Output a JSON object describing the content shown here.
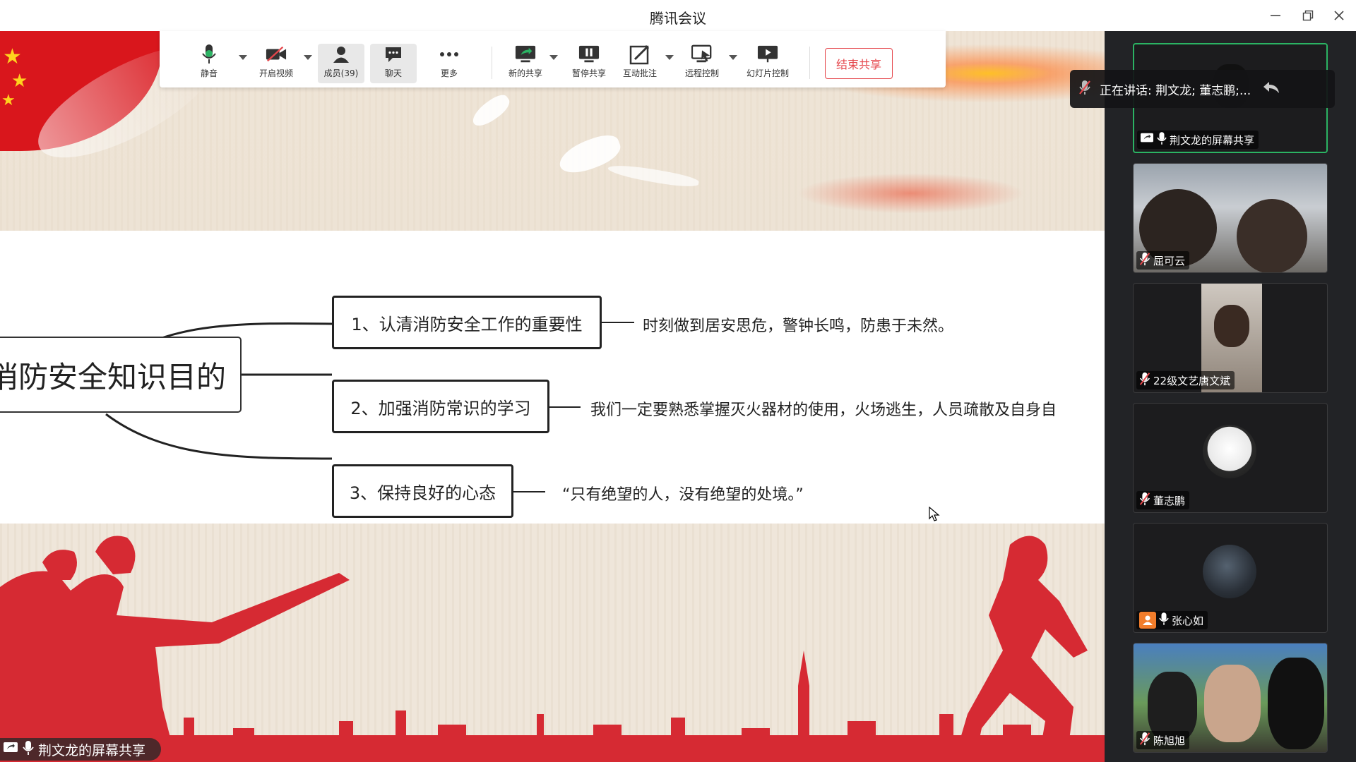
{
  "window": {
    "title": "腾讯会议",
    "minimize_icon": "minimize-icon",
    "restore_icon": "restore-icon",
    "close_icon": "close-icon"
  },
  "toolbar": {
    "buttons": [
      {
        "label": "静音",
        "icon": "microphone-icon"
      },
      {
        "label": "开启视频",
        "icon": "video-off-icon"
      },
      {
        "label": "成员(39)",
        "icon": "members-icon"
      },
      {
        "label": "聊天",
        "icon": "chat-icon"
      },
      {
        "label": "更多",
        "icon": "more-icon"
      },
      {
        "label": "新的共享",
        "icon": "new-share-icon"
      },
      {
        "label": "暂停共享",
        "icon": "pause-share-icon"
      },
      {
        "label": "互动批注",
        "icon": "annotate-icon"
      },
      {
        "label": "远程控制",
        "icon": "remote-control-icon"
      },
      {
        "label": "幻灯片控制",
        "icon": "slide-control-icon"
      }
    ],
    "end_share_label": "结束共享",
    "end_share_color": "#e5464b"
  },
  "slide": {
    "root_label": "消防安全知识目的",
    "branches": [
      {
        "label": "1、认清消防安全工作的重要性",
        "desc": "时刻做到居安思危，警钟长鸣，防患于未然。"
      },
      {
        "label": "2、加强消防常识的学习",
        "desc": "我们一定要熟悉掌握灭火器材的使用，火场逃生，人员疏散及自身自"
      },
      {
        "label": "3、保持良好的心态",
        "desc": "“只有绝望的人，没有绝望的处境。”"
      }
    ],
    "accent_red": "#d62a33"
  },
  "sharer_tag": {
    "label": "荆文龙的屏幕共享"
  },
  "speaking_banner": {
    "text": "正在讲话: 荆文龙; 董志鹏;..."
  },
  "participants": [
    {
      "name": "荆文龙的屏幕共享",
      "status_icon": "screen-share-icon",
      "mic_icon": "microphone-icon",
      "speaking": true
    },
    {
      "name": "屈可云",
      "mic_icon": "mic-muted-icon"
    },
    {
      "name": "22级文艺唐文斌",
      "mic_icon": "mic-muted-icon"
    },
    {
      "name": "董志鹏",
      "mic_icon": "mic-muted-icon"
    },
    {
      "name": "张心如",
      "status_icon": "user-avatar-icon",
      "mic_icon": "microphone-icon"
    },
    {
      "name": "陈旭旭",
      "mic_icon": "mic-muted-icon"
    }
  ],
  "colors": {
    "speaking_border": "#2bb363",
    "panel_bg": "#222326",
    "avatar_orange": "#f27d2b"
  }
}
